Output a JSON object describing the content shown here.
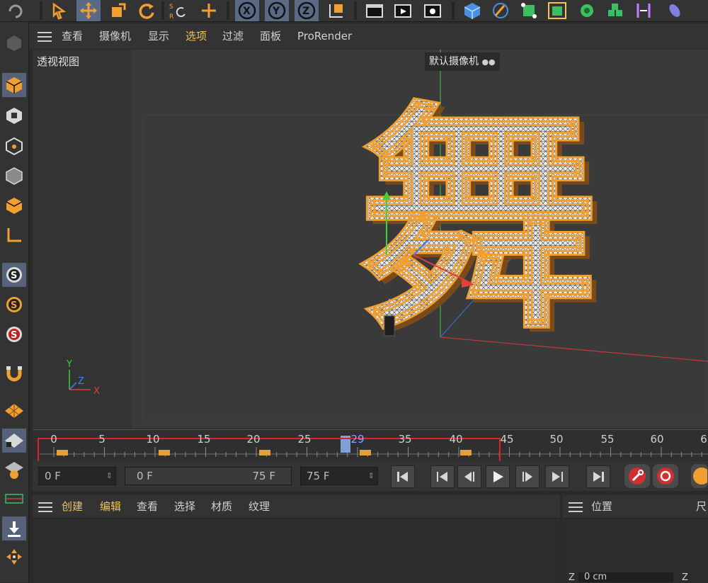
{
  "viewport": {
    "menu": [
      "查看",
      "摄像机",
      "显示",
      "选项",
      "过滤",
      "面板",
      "ProRender"
    ],
    "active_menu": "选项",
    "name": "透视视图",
    "camera": "默认摄像机",
    "axis": {
      "y": "Y",
      "z": "Z",
      "x": "X"
    },
    "character": "舞"
  },
  "timeline": {
    "ticks": [
      "0",
      "5",
      "10",
      "15",
      "20",
      "25",
      "29",
      "35",
      "40",
      "45",
      "50",
      "55",
      "60",
      "6"
    ],
    "current_frame": 29
  },
  "transport": {
    "current": "0 F",
    "range_start": "0 F",
    "range_end": "75 F",
    "end": "75 F"
  },
  "manager_menu": [
    "创建",
    "编辑",
    "查看",
    "选择",
    "材质",
    "纹理"
  ],
  "manager_active": "编辑",
  "attributes": {
    "tab": "位置",
    "tab_right": "尺",
    "coord_label": "Z",
    "coord_value": "0 cm",
    "coord_label_right": "Z"
  },
  "icons": {
    "top": [
      "undo-icon",
      "selection-icon",
      "move-icon",
      "scale-icon",
      "rotate-icon",
      "coordinate-system-icon",
      "add-icon",
      "x-axis-icon",
      "y-axis-icon",
      "z-axis-icon",
      "world-coordinates-icon",
      "render-region-icon",
      "render-view-icon",
      "render-settings-icon",
      "cube-icon",
      "pen-icon",
      "subdivision-icon",
      "array-icon",
      "cloner-icon",
      "deformer-icon",
      "bend-icon",
      "scene-icon"
    ],
    "left": [
      "undo-icon",
      "model-mode-icon",
      "texture-mode-icon",
      "points-mode-icon",
      "edges-mode-icon",
      "polygons-mode-icon",
      "axis-mode-icon",
      "snap-icon",
      "snap-settings-icon",
      "snap-enable-icon",
      "magnet-icon",
      "grid-icon",
      "locked-workplane-icon",
      "workplane-icon",
      "plane-icon",
      "download-icon",
      "move-tool-icon"
    ]
  },
  "colors": {
    "accent": "#f0a030",
    "selected": "#5a6a86",
    "highlight_box": "#e0202a",
    "axis_x": "#e04040",
    "axis_y": "#40d040",
    "axis_z": "#4080ff"
  }
}
